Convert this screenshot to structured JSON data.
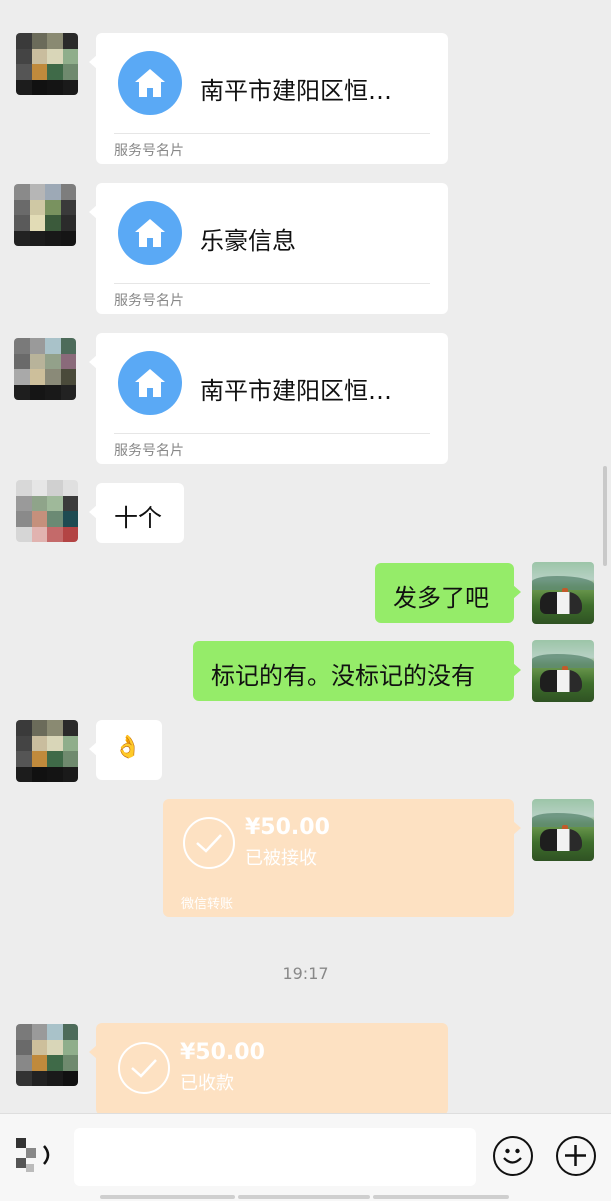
{
  "messages": {
    "card1": {
      "title": "南平市建阳区恒…",
      "footer": "服务号名片"
    },
    "card2": {
      "title": "乐豪信息",
      "footer": "服务号名片"
    },
    "card3": {
      "title": "南平市建阳区恒…",
      "footer": "服务号名片"
    },
    "text1": "十个",
    "text2": "发多了吧",
    "text3": "标记的有。没标记的没有",
    "emoji": "👌",
    "transfer_sent": {
      "amount": "¥50.00",
      "status": "已被接收",
      "footer": "微信转账"
    },
    "timestamp": "19:17",
    "transfer_received": {
      "amount": "¥50.00",
      "status": "已收款"
    }
  },
  "input": {
    "value": "",
    "placeholder": ""
  },
  "icons": {
    "card": "home-icon",
    "transfer": "check-icon",
    "voice": "voice-icon",
    "emoji": "emoji-icon",
    "more": "plus-icon"
  },
  "colors": {
    "background": "#ededed",
    "sent_bubble": "#95ec69",
    "transfer_bubble": "#fde1c2",
    "card_icon": "#5aa9f5"
  }
}
